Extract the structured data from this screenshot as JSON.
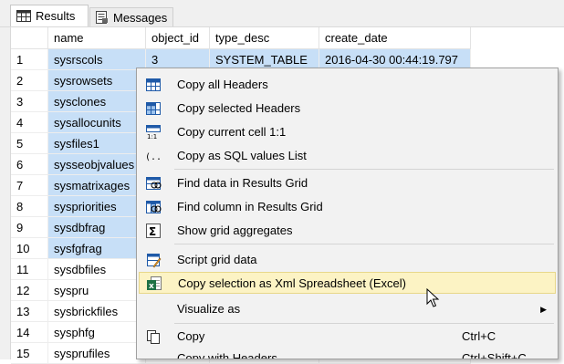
{
  "tabs": [
    {
      "label": "Results",
      "icon": "grid-icon",
      "active": true
    },
    {
      "label": "Messages",
      "icon": "messages-icon",
      "active": false
    }
  ],
  "grid": {
    "columns": [
      "name",
      "object_id",
      "type_desc",
      "create_date"
    ],
    "rows": [
      {
        "num": "1",
        "name": "sysrscols",
        "object_id": "3",
        "type_desc": "SYSTEM_TABLE",
        "create_date": "2016-04-30 00:44:19.797"
      },
      {
        "num": "2",
        "name": "sysrowsets",
        "object_id": "",
        "type_desc": "",
        "create_date": ""
      },
      {
        "num": "3",
        "name": "sysclones",
        "object_id": "",
        "type_desc": "",
        "create_date": ""
      },
      {
        "num": "4",
        "name": "sysallocunits",
        "object_id": "",
        "type_desc": "",
        "create_date": ""
      },
      {
        "num": "5",
        "name": "sysfiles1",
        "object_id": "",
        "type_desc": "",
        "create_date": ""
      },
      {
        "num": "6",
        "name": "sysseobjvalues",
        "object_id": "",
        "type_desc": "",
        "create_date": ""
      },
      {
        "num": "7",
        "name": "sysmatrixages",
        "object_id": "",
        "type_desc": "",
        "create_date": ""
      },
      {
        "num": "8",
        "name": "syspriorities",
        "object_id": "",
        "type_desc": "",
        "create_date": ""
      },
      {
        "num": "9",
        "name": "sysdbfrag",
        "object_id": "",
        "type_desc": "",
        "create_date": ""
      },
      {
        "num": "10",
        "name": "sysfgfrag",
        "object_id": "",
        "type_desc": "",
        "create_date": ""
      },
      {
        "num": "11",
        "name": "sysdbfiles",
        "object_id": "",
        "type_desc": "",
        "create_date": ""
      },
      {
        "num": "12",
        "name": "syspru",
        "object_id": "",
        "type_desc": "",
        "create_date": ""
      },
      {
        "num": "13",
        "name": "sysbrickfiles",
        "object_id": "",
        "type_desc": "",
        "create_date": ""
      },
      {
        "num": "14",
        "name": "sysphfg",
        "object_id": "",
        "type_desc": "",
        "create_date": ""
      },
      {
        "num": "15",
        "name": "sysprufiles",
        "object_id": "",
        "type_desc": "",
        "create_date": ""
      }
    ],
    "selected_rows": 10,
    "selection_color": "#c7dff7"
  },
  "context_menu": {
    "items": [
      {
        "label": "Copy all Headers",
        "icon": "copy-headers-icon"
      },
      {
        "label": "Copy selected Headers",
        "icon": "copy-selected-headers-icon"
      },
      {
        "label": "Copy current cell 1:1",
        "icon": "copy-cell-icon"
      },
      {
        "label": "Copy as SQL values List",
        "icon": "sql-values-icon"
      },
      {
        "label": "Find data in Results Grid",
        "icon": "find-data-icon"
      },
      {
        "label": "Find column in Results Grid",
        "icon": "find-column-icon"
      },
      {
        "label": "Show grid aggregates",
        "icon": "sigma-icon"
      },
      {
        "label": "Script grid data",
        "icon": "script-icon"
      },
      {
        "label": "Copy selection as Xml Spreadsheet (Excel)",
        "icon": "excel-icon",
        "highlighted": true
      },
      {
        "label": "Visualize as",
        "icon": "",
        "submenu": true
      },
      {
        "label": "Copy",
        "icon": "copy-icon",
        "shortcut": "Ctrl+C"
      },
      {
        "label": "Copy with Headers",
        "icon": "",
        "shortcut": "Ctrl+Shift+C"
      }
    ],
    "highlight_color": "#fcf3c4"
  }
}
